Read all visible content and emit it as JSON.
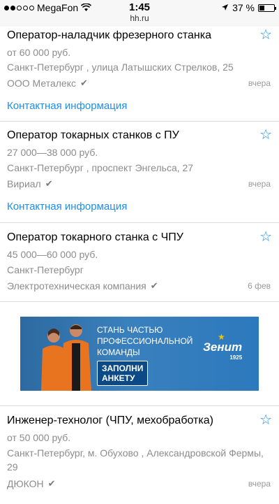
{
  "status": {
    "carrier": "MegaFon",
    "time": "1:45",
    "url": "hh.ru",
    "battery": "37 %",
    "signal_dots": 5,
    "signal_filled": 2,
    "battery_level": 0.37
  },
  "vacancies": [
    {
      "title": "Оператор-наладчик фрезерного станка",
      "salary": "от 60 000 руб.",
      "address": "Санкт-Петербург , улица Латышских Стрелков, 25",
      "company": "ООО Металекс",
      "date": "вчера",
      "contact": "Контактная информация"
    },
    {
      "title": "Оператор токарных станков с ПУ",
      "salary": "27 000—38 000 руб.",
      "address": "Санкт-Петербург , проспект Энгельса, 27",
      "company": "Вириал",
      "date": "вчера",
      "contact": "Контактная информация"
    },
    {
      "title": "Оператор токарного станка с ЧПУ",
      "salary": "45 000—60 000 руб.",
      "address": "Санкт-Петербург",
      "company": "Электротехническая компания",
      "date": "6 фев"
    },
    {
      "title": "Инженер-технолог (ЧПУ, мехобработка)",
      "salary": "от 50 000 руб.",
      "address": "Санкт-Петербург, м. Обухово , Александровской Фермы, 29",
      "company": "ДЮКОН",
      "date": "вчера"
    }
  ],
  "banner": {
    "line1": "СТАНЬ ЧАСТЬЮ",
    "line2": "ПРОФЕССИОНАЛЬНОЙ",
    "line3": "КОМАНДЫ",
    "button_line1": "ЗАПОЛНИ",
    "button_line2": "АНКЕТУ",
    "logo": "Зенит",
    "logo_year": "1925"
  },
  "colors": {
    "accent": "#1f8ee9",
    "muted_text": "#8c8c8c",
    "banner_blue": "#2f72b0"
  }
}
